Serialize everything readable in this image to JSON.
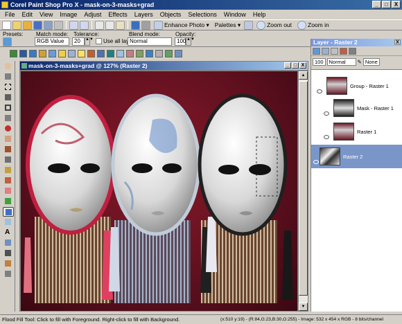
{
  "window": {
    "title": "Corel Paint Shop Pro X - mask-on-3-masks+grad",
    "minimize": "_",
    "maximize": "□",
    "close": "X"
  },
  "menu": [
    "File",
    "Edit",
    "View",
    "Image",
    "Adjust",
    "Effects",
    "Layers",
    "Objects",
    "Selections",
    "Window",
    "Help"
  ],
  "toolbar": {
    "enhance_photo": "Enhance Photo ▾",
    "palettes": "Palettes ▾",
    "zoom_out": "Zoom out",
    "zoom_in": "Zoom in"
  },
  "options": {
    "presets_label": "Presets:",
    "match_mode_label": "Match mode:",
    "match_mode_value": "RGB Value",
    "tolerance_label": "Tolerance:",
    "tolerance_value": "20",
    "use_all_layers_label": "Use all layers",
    "blend_mode_label": "Blend mode:",
    "blend_mode_value": "Normal",
    "opacity_label": "Opacity:",
    "opacity_value": "100"
  },
  "document": {
    "title": "mask-on-3-masks+grad @ 127% (Raster 2)"
  },
  "layer_palette": {
    "title": "Layer - Raster 2",
    "opacity_value": "100",
    "blend_value": "Normal",
    "link_value": "None",
    "layers": [
      {
        "name": "Group - Raster 1"
      },
      {
        "name": "Mask - Raster 1"
      },
      {
        "name": "Raster 1"
      },
      {
        "name": "Raster 2",
        "selected": true
      }
    ]
  },
  "status": {
    "tool_hint": "Flood Fill Tool: Click to fill with Foreground. Right-click to fill with Background.",
    "coords": "(x:510 y:19) - (R:84,G:23,B:30,O:255) - Image:  532 x 454 x RGB - 8 bits/channel"
  },
  "colors": {
    "title_start": "#0a246a",
    "title_end": "#3a6ea5",
    "selection": "#7a96c8",
    "canvas_bg": "#6a1424"
  }
}
